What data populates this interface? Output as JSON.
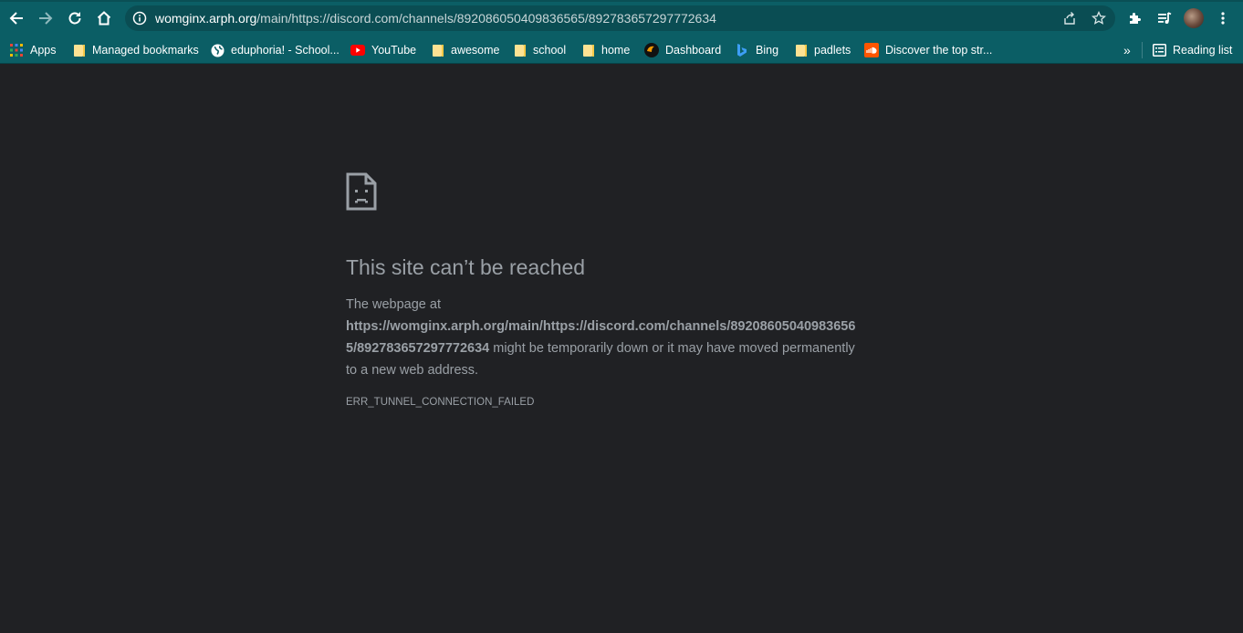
{
  "browser": {
    "url_host": "womginx.arph.org",
    "url_path": "/main/https://discord.com/channels/892086050409836565/892783657297772634",
    "colors": {
      "toolbar": "#0b5e65",
      "omnibox": "#0a4d53",
      "page_bg": "#202124",
      "text": "#9aa0a6"
    }
  },
  "bookmarks": {
    "items": [
      {
        "label": "Apps",
        "icon": "apps-grid-icon"
      },
      {
        "label": "Managed bookmarks",
        "icon": "folder-icon"
      },
      {
        "label": "eduphoria! - School...",
        "icon": "globe-icon"
      },
      {
        "label": "YouTube",
        "icon": "youtube-icon"
      },
      {
        "label": "awesome",
        "icon": "folder-icon"
      },
      {
        "label": "school",
        "icon": "folder-icon"
      },
      {
        "label": "home",
        "icon": "folder-icon"
      },
      {
        "label": "Dashboard",
        "icon": "dashboard-icon"
      },
      {
        "label": "Bing",
        "icon": "bing-icon"
      },
      {
        "label": "padlets",
        "icon": "folder-icon"
      },
      {
        "label": "Discover the top str...",
        "icon": "soundcloud-icon"
      }
    ],
    "overflow": "»",
    "reading_list": "Reading list"
  },
  "error": {
    "title": "This site can’t be reached",
    "intro": "The webpage at",
    "url_line1": "https://womginx.arph.org/main/https://discord.com/channels/89208605040983656",
    "url_line2": "5/892783657297772634",
    "suffix": " might be temporarily down or it may have moved permanently",
    "suffix2": "to a new web address.",
    "code": "ERR_TUNNEL_CONNECTION_FAILED"
  }
}
